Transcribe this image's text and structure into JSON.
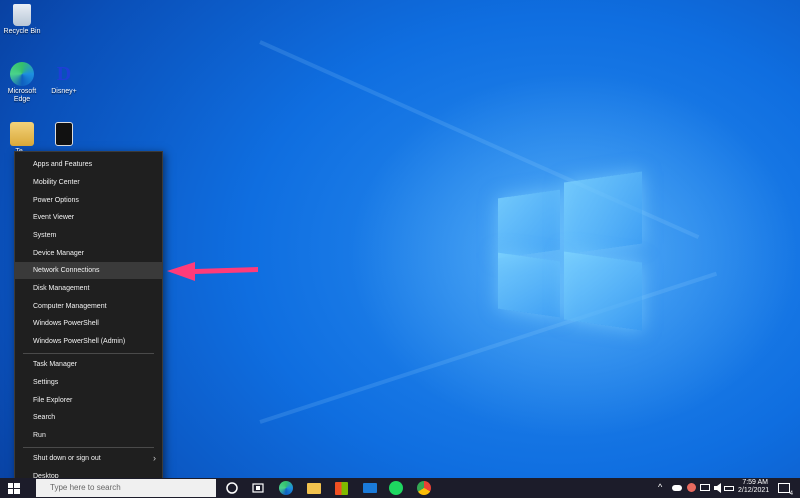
{
  "desktop_icons": [
    {
      "label": "Recycle Bin",
      "icon": "recycle-bin-icon"
    },
    {
      "label": "Microsoft Edge",
      "icon": "edge-icon"
    },
    {
      "label": "Disney+",
      "icon": "disney-plus-icon"
    },
    {
      "label": "Te...",
      "icon": "user-folder-icon"
    },
    {
      "label": "",
      "icon": "app-shortcut-icon"
    }
  ],
  "context_menu": {
    "group1": [
      "Apps and Features",
      "Mobility Center",
      "Power Options",
      "Event Viewer",
      "System",
      "Device Manager",
      "Network Connections",
      "Disk Management",
      "Computer Management",
      "Windows PowerShell",
      "Windows PowerShell (Admin)"
    ],
    "group2": [
      "Task Manager",
      "Settings",
      "File Explorer",
      "Search",
      "Run"
    ],
    "group3": [
      "Shut down or sign out",
      "Desktop"
    ],
    "highlighted": "Network Connections",
    "submenu_chevron": "›"
  },
  "taskbar": {
    "search_placeholder": "Type here to search",
    "time": "7:59 AM",
    "date": "2/12/2021",
    "notification_count": "4",
    "tray_arrow": "^"
  },
  "colors": {
    "menu_bg": "#1f1f1f",
    "highlight": "#3a3a3a",
    "arrow": "#ff3b7a",
    "taskbar": "#1c1c2a"
  }
}
